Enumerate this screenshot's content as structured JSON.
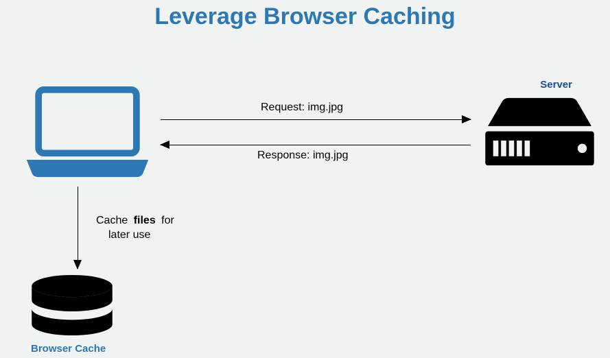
{
  "title": "Leverage Browser Caching",
  "labels": {
    "server": "Server",
    "browser_cache": "Browser Cache",
    "request": "Request: img.jpg",
    "response": "Response: img.jpg",
    "cache_line1_a": "Cache",
    "cache_line1_b": "files",
    "cache_line1_c": "for",
    "cache_line2": "later use"
  },
  "colors": {
    "accent": "#2b78b5",
    "server_label": "#1b4f8d",
    "black": "#000000",
    "bg": "#f1f2f2"
  },
  "diagram": {
    "nodes": [
      {
        "id": "client",
        "type": "laptop",
        "label": null
      },
      {
        "id": "server",
        "type": "server",
        "label": "Server"
      },
      {
        "id": "browser_cache",
        "type": "database",
        "label": "Browser Cache"
      }
    ],
    "edges": [
      {
        "from": "client",
        "to": "server",
        "label": "Request: img.jpg",
        "direction": "right"
      },
      {
        "from": "server",
        "to": "client",
        "label": "Response: img.jpg",
        "direction": "left"
      },
      {
        "from": "client",
        "to": "browser_cache",
        "label": "Cache files for later use",
        "direction": "down"
      }
    ]
  }
}
